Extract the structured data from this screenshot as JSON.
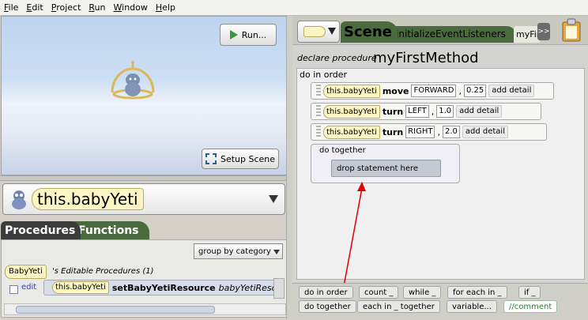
{
  "menubar": {
    "items": [
      "File",
      "Edit",
      "Project",
      "Run",
      "Window",
      "Help"
    ]
  },
  "scene_view": {
    "run_label": "Run...",
    "setup_scene_label": "Setup Scene"
  },
  "selector": {
    "value": "this.babyYeti"
  },
  "left_tabs": {
    "procedures": "Procedures",
    "functions": "Functions"
  },
  "group_select": {
    "value": "group by category"
  },
  "procedures_list": {
    "owner": "BabyYeti",
    "editable_label": "'s Editable Procedures (1)",
    "items": [
      {
        "edit": "edit",
        "target": "this.babyYeti",
        "name": "setBabyYetiResource",
        "param": "babyYetiResource"
      }
    ]
  },
  "editor_tabs": {
    "scene": "Scene",
    "initialize": "initializeEventListeners",
    "myfirst": "myFirstMethod",
    "overflow": ">>"
  },
  "method": {
    "declare": "declare procedure",
    "name": "myFirstMethod",
    "do_in_order": "do in order",
    "statements": [
      {
        "target": "this.babyYeti",
        "verb": "move",
        "dir": "FORWARD",
        "amount": "0.25",
        "add_detail": "add detail"
      },
      {
        "target": "this.babyYeti",
        "verb": "turn",
        "dir": "LEFT",
        "amount": "1.0",
        "add_detail": "add detail"
      },
      {
        "target": "this.babyYeti",
        "verb": "turn",
        "dir": "RIGHT",
        "amount": "2.0",
        "add_detail": "add detail"
      }
    ],
    "do_together": "do together",
    "drop_placeholder": "drop statement here"
  },
  "toolbox": {
    "do_in_order": "do in order",
    "count": "count _",
    "while": "while _",
    "for_each_in": "for each in _",
    "if": "if _",
    "do_together": "do together",
    "each_in_together": "each in _ together",
    "variable": "variable...",
    "comment": "//comment"
  },
  "colors": {
    "scene_tab": "#4a6b3e",
    "instance_pill": "#fdf6c4",
    "arrow": "#e00000"
  }
}
